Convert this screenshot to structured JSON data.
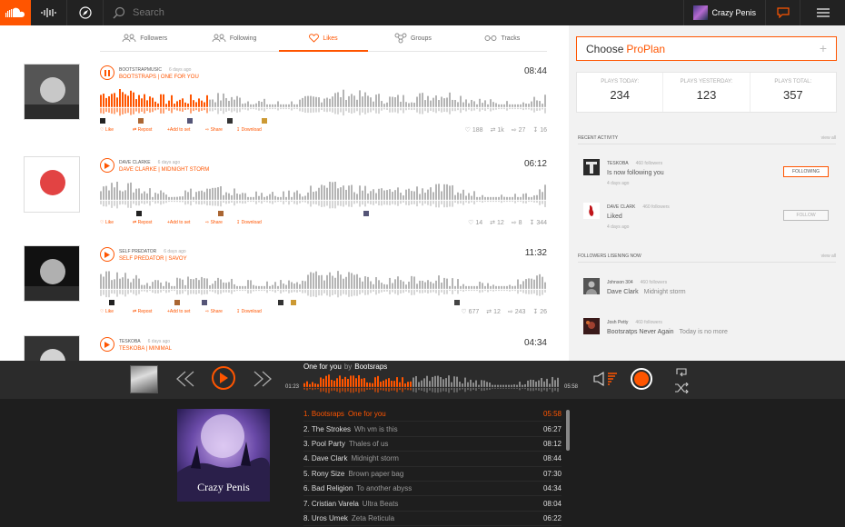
{
  "colors": {
    "accent": "#ff5500",
    "topbar": "#222222",
    "player": "#2b2b2b",
    "queue": "#1e1e1e"
  },
  "topbar": {
    "search_placeholder": "Search",
    "username": "Crazy Penis",
    "icons": [
      "soundcloud-logo-icon",
      "waveform-icon",
      "compass-icon",
      "search-icon",
      "chat-icon",
      "menu-icon"
    ]
  },
  "tabs": [
    {
      "label": "Followers",
      "icon": "followers-icon"
    },
    {
      "label": "Following",
      "icon": "following-icon"
    },
    {
      "label": "Likes",
      "icon": "heart-icon",
      "active": true
    },
    {
      "label": "Groups",
      "icon": "groups-icon"
    },
    {
      "label": "Tracks",
      "icon": "tracks-icon"
    }
  ],
  "tracks": [
    {
      "artist": "BOOTSTRAPMUSIC",
      "time": "6 days ago",
      "title": "BOOTSTRAPS | ONE FOR YOU",
      "duration": "08:44",
      "progress": 0.24,
      "playing": true,
      "stats": {
        "likes": "188",
        "reposts": "1k",
        "shares": "27",
        "downloads": "16"
      }
    },
    {
      "artist": "DAVE CLARKE",
      "time": "6 days ago",
      "title": "DAVE CLARKE | MIDNIGHT STORM",
      "duration": "06:12",
      "progress": 0,
      "stats": {
        "likes": "14",
        "reposts": "12",
        "shares": "8",
        "downloads": "344"
      }
    },
    {
      "artist": "SELF PREDATOR",
      "time": "6 days ago",
      "title": "SELF PREDATOR | SAVOY",
      "duration": "11:32",
      "progress": 0,
      "stats": {
        "likes": "677",
        "reposts": "12",
        "shares": "243",
        "downloads": "26"
      }
    },
    {
      "artist": "TESKOBA",
      "time": "6 days ago",
      "title": "TESKOBA | MINIMAL",
      "duration": "04:34",
      "progress": 0
    }
  ],
  "actions": {
    "like": "Like",
    "repost": "Repost",
    "add": "+Add to set",
    "share": "Share",
    "download": "Download"
  },
  "sidebar": {
    "pro_prefix": "Choose",
    "pro_highlight": "ProPlan",
    "plays": [
      {
        "label": "PLAYS TODAY:",
        "value": "234"
      },
      {
        "label": "PLAYS YESTERDAY:",
        "value": "123"
      },
      {
        "label": "PLAYS TOTAL:",
        "value": "357"
      }
    ],
    "recent_title": "RECENT ACTIVITY",
    "view_all": "view all",
    "activity": [
      {
        "name": "TESKOBA",
        "followers": "460 followers",
        "text": "Is now following you",
        "time": "4 days ago",
        "button": "FOLLOWING"
      },
      {
        "name": "DAVE CLARK",
        "followers": "460 followers",
        "text": "Liked",
        "time": "4 days ago",
        "button": "FOLLOW"
      }
    ],
    "listening_title": "FOLLOWERS LISENING NOW",
    "listening": [
      {
        "name": "Johnson 304",
        "followers": "460 followers",
        "artist": "Dave Clark",
        "track": "Midnight storm"
      },
      {
        "name": "Josh Petty",
        "followers": "460 followers",
        "artist": "Bootsratps Never Again",
        "track": "Today is no more"
      }
    ]
  },
  "player": {
    "song": "One for you",
    "by": "by",
    "artist": "Bootsraps",
    "elapsed": "01:23",
    "total": "05:58",
    "progress": 0.42
  },
  "queue": [
    {
      "n": "1.",
      "artist": "Bootsraps",
      "track": "One for you",
      "duration": "05:58",
      "current": true
    },
    {
      "n": "2.",
      "artist": "The Strokes",
      "track": "Wh vm is this",
      "duration": "06:27"
    },
    {
      "n": "3.",
      "artist": "Pool Party",
      "track": "Thales of us",
      "duration": "08:12"
    },
    {
      "n": "4.",
      "artist": "Dave Clark",
      "track": "Midnight storm",
      "duration": "08:44"
    },
    {
      "n": "5.",
      "artist": "Rony Size",
      "track": "Brown paper bag",
      "duration": "07:30"
    },
    {
      "n": "6.",
      "artist": "Bad Religion",
      "track": "To another abyss",
      "duration": "04:34"
    },
    {
      "n": "7.",
      "artist": "Cristian Varela",
      "track": "Ultra Beats",
      "duration": "08:04"
    },
    {
      "n": "8.",
      "artist": "Uros Umek",
      "track": "Zeta Reticula",
      "duration": "06:22"
    }
  ],
  "queue_art_text": "Crazy Penis"
}
